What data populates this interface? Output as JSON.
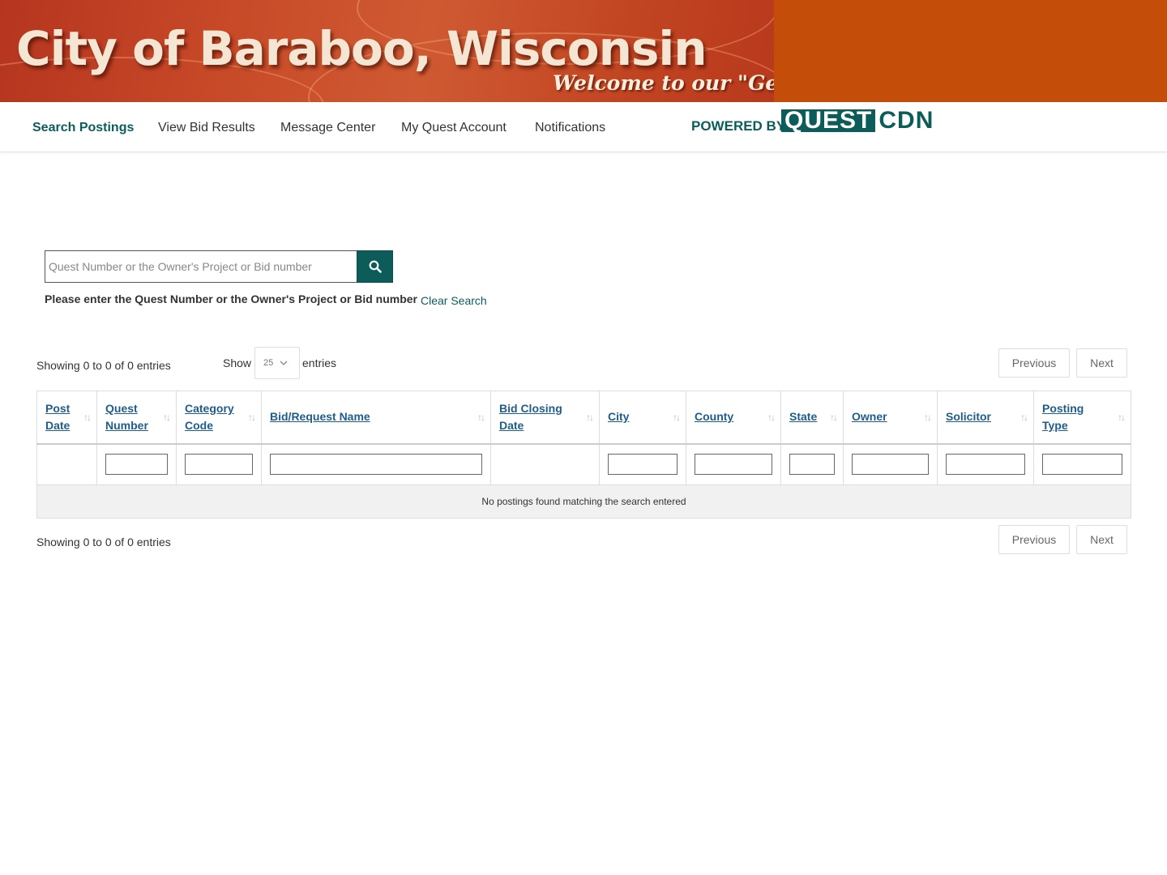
{
  "banner": {
    "title": "City of Baraboo, Wisconsin",
    "tagline": "Welcome to our \"Gem\" City!"
  },
  "nav": {
    "items": [
      {
        "label": "Search Postings",
        "active": true
      },
      {
        "label": "View Bid Results",
        "active": false
      },
      {
        "label": "Message Center",
        "active": false
      },
      {
        "label": "My Quest Account",
        "active": false
      },
      {
        "label": "Notifications",
        "active": false
      }
    ],
    "powered_by": "POWERED BY",
    "logo_left": "QUEST",
    "logo_right": "CDN"
  },
  "search": {
    "placeholder": "Quest Number or the Owner's Project or Bid number",
    "value": "",
    "button_icon": "search-icon",
    "hint": "Please enter the Quest Number or the Owner's Project or Bid number",
    "clear_label": "Clear Search"
  },
  "table_controls": {
    "info_top": "Showing 0 to 0 of 0 entries",
    "info_bottom": "Showing 0 to 0 of 0 entries",
    "show_label": "Show",
    "page_size": "25",
    "entries_label": "entries",
    "previous": "Previous",
    "next": "Next"
  },
  "table": {
    "columns": [
      {
        "label": "Post Date",
        "has_filter": false
      },
      {
        "label": "Quest Number",
        "has_filter": true
      },
      {
        "label": "Category Code",
        "has_filter": true
      },
      {
        "label": "Bid/Request Name",
        "has_filter": true
      },
      {
        "label": "Bid Closing Date",
        "has_filter": false
      },
      {
        "label": "City",
        "has_filter": true
      },
      {
        "label": "County",
        "has_filter": true
      },
      {
        "label": "State",
        "has_filter": true
      },
      {
        "label": "Owner",
        "has_filter": true
      },
      {
        "label": "Solicitor",
        "has_filter": true
      },
      {
        "label": "Posting Type",
        "has_filter": true
      }
    ],
    "empty_message": "No postings found matching the search entered"
  },
  "colors": {
    "brand_teal": "#0c5d5a",
    "link_blue": "#1f5d8c",
    "banner_orange": "#c44d0a"
  }
}
